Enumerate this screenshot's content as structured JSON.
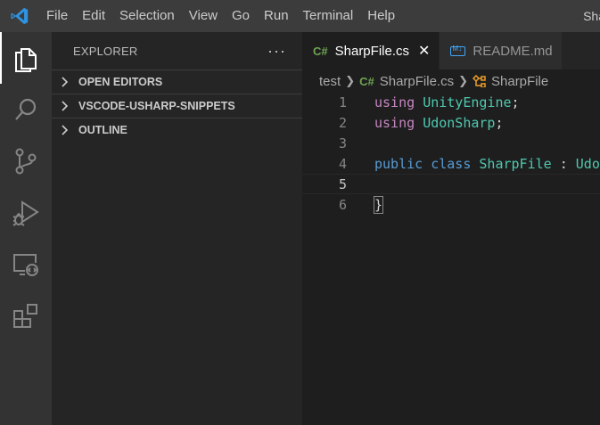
{
  "titlebar": {
    "menu": [
      "File",
      "Edit",
      "Selection",
      "View",
      "Go",
      "Run",
      "Terminal",
      "Help"
    ],
    "title_fragment": "Sha"
  },
  "activitybar": {
    "items": [
      "explorer-icon",
      "search-icon",
      "source-control-icon",
      "run-debug-icon",
      "remote-explorer-icon",
      "extensions-icon"
    ]
  },
  "sidebar": {
    "title": "EXPLORER",
    "more": "···",
    "sections": [
      "OPEN EDITORS",
      "VSCODE-USHARP-SNIPPETS",
      "OUTLINE"
    ]
  },
  "tabs": [
    {
      "badge": "C#",
      "label": "SharpFile.cs",
      "active": true,
      "close": "✕"
    },
    {
      "badge": "M↓",
      "label": "README.md",
      "active": false
    }
  ],
  "breadcrumb": {
    "folder": "test",
    "file_badge": "C#",
    "file": "SharpFile.cs",
    "symbol": "SharpFile"
  },
  "editor": {
    "line_numbers": [
      "1",
      "2",
      "3",
      "4",
      "5",
      "6"
    ],
    "current_line": 5,
    "lines": {
      "l1": {
        "kw": "using",
        "type": "UnityEngine",
        "punct": ";"
      },
      "l2": {
        "kw": "using",
        "type": "UdonSharp",
        "punct": ";"
      },
      "l4": {
        "kw1": "public",
        "kw2": "class",
        "type": "SharpFile",
        "rest": " : ",
        "type2": "Udon"
      },
      "l6": {
        "brace": "}"
      }
    }
  },
  "colors": {
    "accent": "#0078d4",
    "keyword_control": "#c586c0",
    "keyword": "#569cd6",
    "type": "#4ec9b0",
    "csharp_badge": "#6ea552"
  }
}
